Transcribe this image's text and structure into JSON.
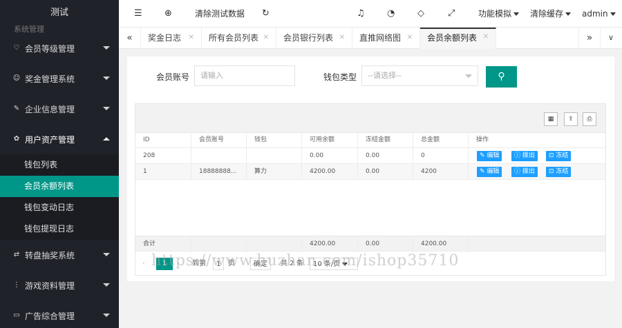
{
  "sidebar": {
    "logo": "测试",
    "cut_item": "系统管理",
    "menus": [
      {
        "label": "会员等级管理",
        "icon": "heart-icon"
      },
      {
        "label": "奖金管理系统",
        "icon": "smile-icon"
      },
      {
        "label": "企业信息管理",
        "icon": "edit-icon"
      },
      {
        "label": "用户资产管理",
        "icon": "gear-icon",
        "expanded": true
      }
    ],
    "subitems": [
      "钱包列表",
      "会员余额列表",
      "钱包变动日志",
      "钱包提现日志"
    ],
    "active_subitem": "会员余额列表",
    "menus_after": [
      {
        "label": "转盘抽奖系统",
        "icon": "transfer-icon"
      },
      {
        "label": "游戏资料管理",
        "icon": "dots-icon"
      },
      {
        "label": "广告综合管理",
        "icon": "ad-icon"
      }
    ]
  },
  "header": {
    "clear_test_data": "清除测试数据",
    "simulate": "功能模拟",
    "clear_cache": "清除缓存",
    "user": "admin"
  },
  "tabs": {
    "items": [
      "奖金日志",
      "所有会员列表",
      "会员银行列表",
      "直推网络图",
      "会员余额列表"
    ],
    "active": "会员余额列表"
  },
  "filters": {
    "account_label": "会员账号",
    "account_placeholder": "请输入",
    "wallet_label": "钱包类型",
    "wallet_placeholder": "--请选择--"
  },
  "table": {
    "columns": [
      "ID",
      "会员账号",
      "钱包",
      "可用余额",
      "冻结金额",
      "总金额",
      "操作"
    ],
    "rows": [
      {
        "id": "208",
        "account": "",
        "wallet": "",
        "available": "0.00",
        "frozen": "0.00",
        "total": "0"
      },
      {
        "id": "1",
        "account": "18888888...",
        "wallet": "算力",
        "available": "4200.00",
        "frozen": "0.00",
        "total": "4200"
      }
    ],
    "actions": {
      "edit": "编辑",
      "withdraw": "拨出",
      "freeze": "冻结"
    },
    "total_label": "合计",
    "totals": {
      "available": "4200.00",
      "frozen": "0.00",
      "total": "4200.00"
    }
  },
  "pager": {
    "current": "1",
    "goto_label": "到第",
    "page_input": "1",
    "page_unit": "页",
    "confirm": "确定",
    "count_text": "共 2 条",
    "per_page": "10 条/页"
  },
  "watermark": "https://www.huzhan.com/ishop35710",
  "colors": {
    "accent": "#009688",
    "sidebar": "#20222a",
    "action": "#1e9fff"
  }
}
